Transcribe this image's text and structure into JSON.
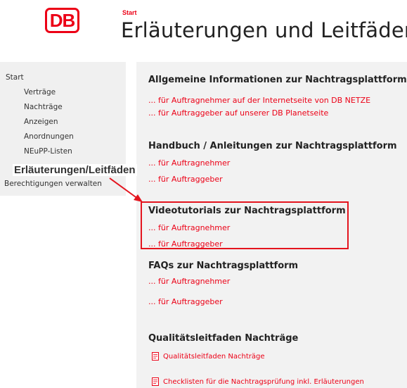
{
  "header": {
    "logo_text": "DB",
    "breadcrumb": "Start",
    "title": "Erläuterungen und Leitfäden"
  },
  "sidebar": {
    "root": "Start",
    "items": [
      {
        "label": "Verträge"
      },
      {
        "label": "Nachträge"
      },
      {
        "label": "Anzeigen"
      },
      {
        "label": "Anordnungen"
      },
      {
        "label": "NEuPP-Listen"
      }
    ],
    "active": "Erläuterungen/Leitfäden",
    "manage": "Berechtigungen verwalten"
  },
  "sections": [
    {
      "heading": "Allgemeine Informationen zur Nachtragsplattform",
      "links": [
        "... für Auftragnehmer auf der Internetseite von DB NETZE",
        "... für Auftraggeber auf unserer DB Planetseite"
      ]
    },
    {
      "heading": "Handbuch / Anleitungen zur Nachtragsplattform",
      "links": [
        "... für Auftragnehmer",
        "... für Auftraggeber"
      ]
    },
    {
      "heading": "Videotutorials zur Nachtragsplattform",
      "links": [
        "... für Auftragnehmer",
        "... für Auftraggeber"
      ]
    },
    {
      "heading": "FAQs zur Nachtragsplattform",
      "links": [
        "... für Auftragnehmer",
        "... für Auftraggeber"
      ]
    },
    {
      "heading": "Qualitätsleitfaden Nachträge",
      "docs": [
        {
          "label": "Qualitätsleitfaden Nachträge",
          "icon": "document-icon"
        },
        {
          "label": "Checklisten für die Nachtragsprüfung inkl. Erläuterungen",
          "icon": "document-icon"
        }
      ]
    }
  ],
  "colors": {
    "brand_red": "#ec0016",
    "highlight_red": "#e4141e",
    "panel_gray": "#f0f0f0"
  }
}
